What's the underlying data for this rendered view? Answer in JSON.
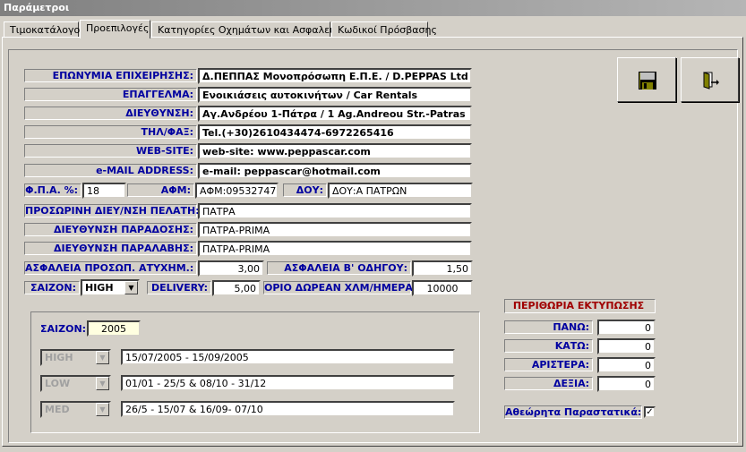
{
  "window": {
    "title": "Παράμετροι"
  },
  "tabs": [
    {
      "label": "Τιμοκατάλογος"
    },
    {
      "label": "Προεπιλογές"
    },
    {
      "label": "Κατηγορίες Οχημάτων και Ασφαλειών"
    },
    {
      "label": "Κωδικοί Πρόσβασης"
    }
  ],
  "company": {
    "name_label": "ΕΠΩΝΥΜΙΑ ΕΠΙΧΕΙΡΗΣΗΣ:",
    "name_value": "Δ.ΠΕΠΠΑΣ Μονοπρόσωπη Ε.Π.Ε. / D.PEPPAS Ltd",
    "job_label": "ΕΠΑΓΓΕΛΜΑ:",
    "job_value": "Ενοικιάσεις αυτοκινήτων / Car Rentals",
    "address_label": "ΔΙΕΥΘΥΝΣΗ:",
    "address_value": "Αγ.Ανδρέου 1-Πάτρα / 1 Ag.Andreou Str.-Patras",
    "phone_label": "ΤΗΛ/ΦΑΞ:",
    "phone_value": "Tel.(+30)2610434474-6972265416",
    "web_label": "WEB-SITE:",
    "web_value": "web-site: www.peppascar.com",
    "email_label": "e-MAIL ADDRESS:",
    "email_value": "e-mail: peppascar@hotmail.com",
    "vat_label": "Φ.Π.Α. %:",
    "vat_value": "18",
    "afm_label": "ΑΦΜ:",
    "afm_value": "ΑΦΜ:095327473",
    "doy_label": "ΔΟΥ:",
    "doy_value": "ΔΟΥ:Α ΠΑΤΡΩΝ"
  },
  "customer": {
    "temp_address_label": "ΠΡΟΣΩΡΙΝΗ ΔΙΕΥ/ΝΣΗ ΠΕΛΑΤΗ:",
    "temp_address_value": "ΠΑΤΡΑ",
    "delivery_address_label": "ΔΙΕΥΘΥΝΣΗ ΠΑΡΑΔΟΣΗΣ:",
    "delivery_address_value": "ΠΑΤΡΑ-PRIMA",
    "pickup_address_label": "ΔΙΕΥΘΥΝΣΗ ΠΑΡΑΛΑΒΗΣ:",
    "pickup_address_value": "ΠΑΤΡΑ-PRIMA"
  },
  "insurance": {
    "personal_label": "ΑΣΦΑΛΕΙΑ ΠΡΟΣΩΠ. ΑΤΥΧΗΜ.:",
    "personal_value": "3,00",
    "second_driver_label": "ΑΣΦΑΛΕΙΑ Β' ΟΔΗΓΟΥ:",
    "second_driver_value": "1,50"
  },
  "misc": {
    "season_label": "ΣΑΙΖΟΝ:",
    "season_value": "HIGH",
    "delivery_label": "DELIVERY:",
    "delivery_value": "5,00",
    "free_km_label": "ΟΡΙΟ ΔΩΡΕΑΝ ΧΛΜ/ΗΜΕΡΑ:",
    "free_km_value": "10000"
  },
  "seasons": {
    "year_label": "ΣΑΙΖΟΝ:",
    "year_value": "2005",
    "rows": [
      {
        "season": "HIGH",
        "range": "15/07/2005 - 15/09/2005"
      },
      {
        "season": "LOW",
        "range": "01/01 - 25/5 &  08/10 - 31/12"
      },
      {
        "season": "MED",
        "range": "26/5 - 15/07 & 16/09- 07/10"
      }
    ]
  },
  "margins": {
    "title": "ΠΕΡΙΘΩΡΙΑ ΕΚΤΥΠΩΣΗΣ",
    "top_label": "ΠΑΝΩ:",
    "top_value": "0",
    "bottom_label": "ΚΑΤΩ:",
    "bottom_value": "0",
    "left_label": "ΑΡΙΣΤΕΡΑ:",
    "left_value": "0",
    "right_label": "ΔΕΞΙΑ:",
    "right_value": "0"
  },
  "invisible_docs": {
    "label": "Αθεώρητα Παραστατικά:",
    "checked": true,
    "mark": "✓"
  },
  "toolbar": {
    "save_icon": "floppy-disk-icon",
    "exit_icon": "exit-door-icon"
  }
}
